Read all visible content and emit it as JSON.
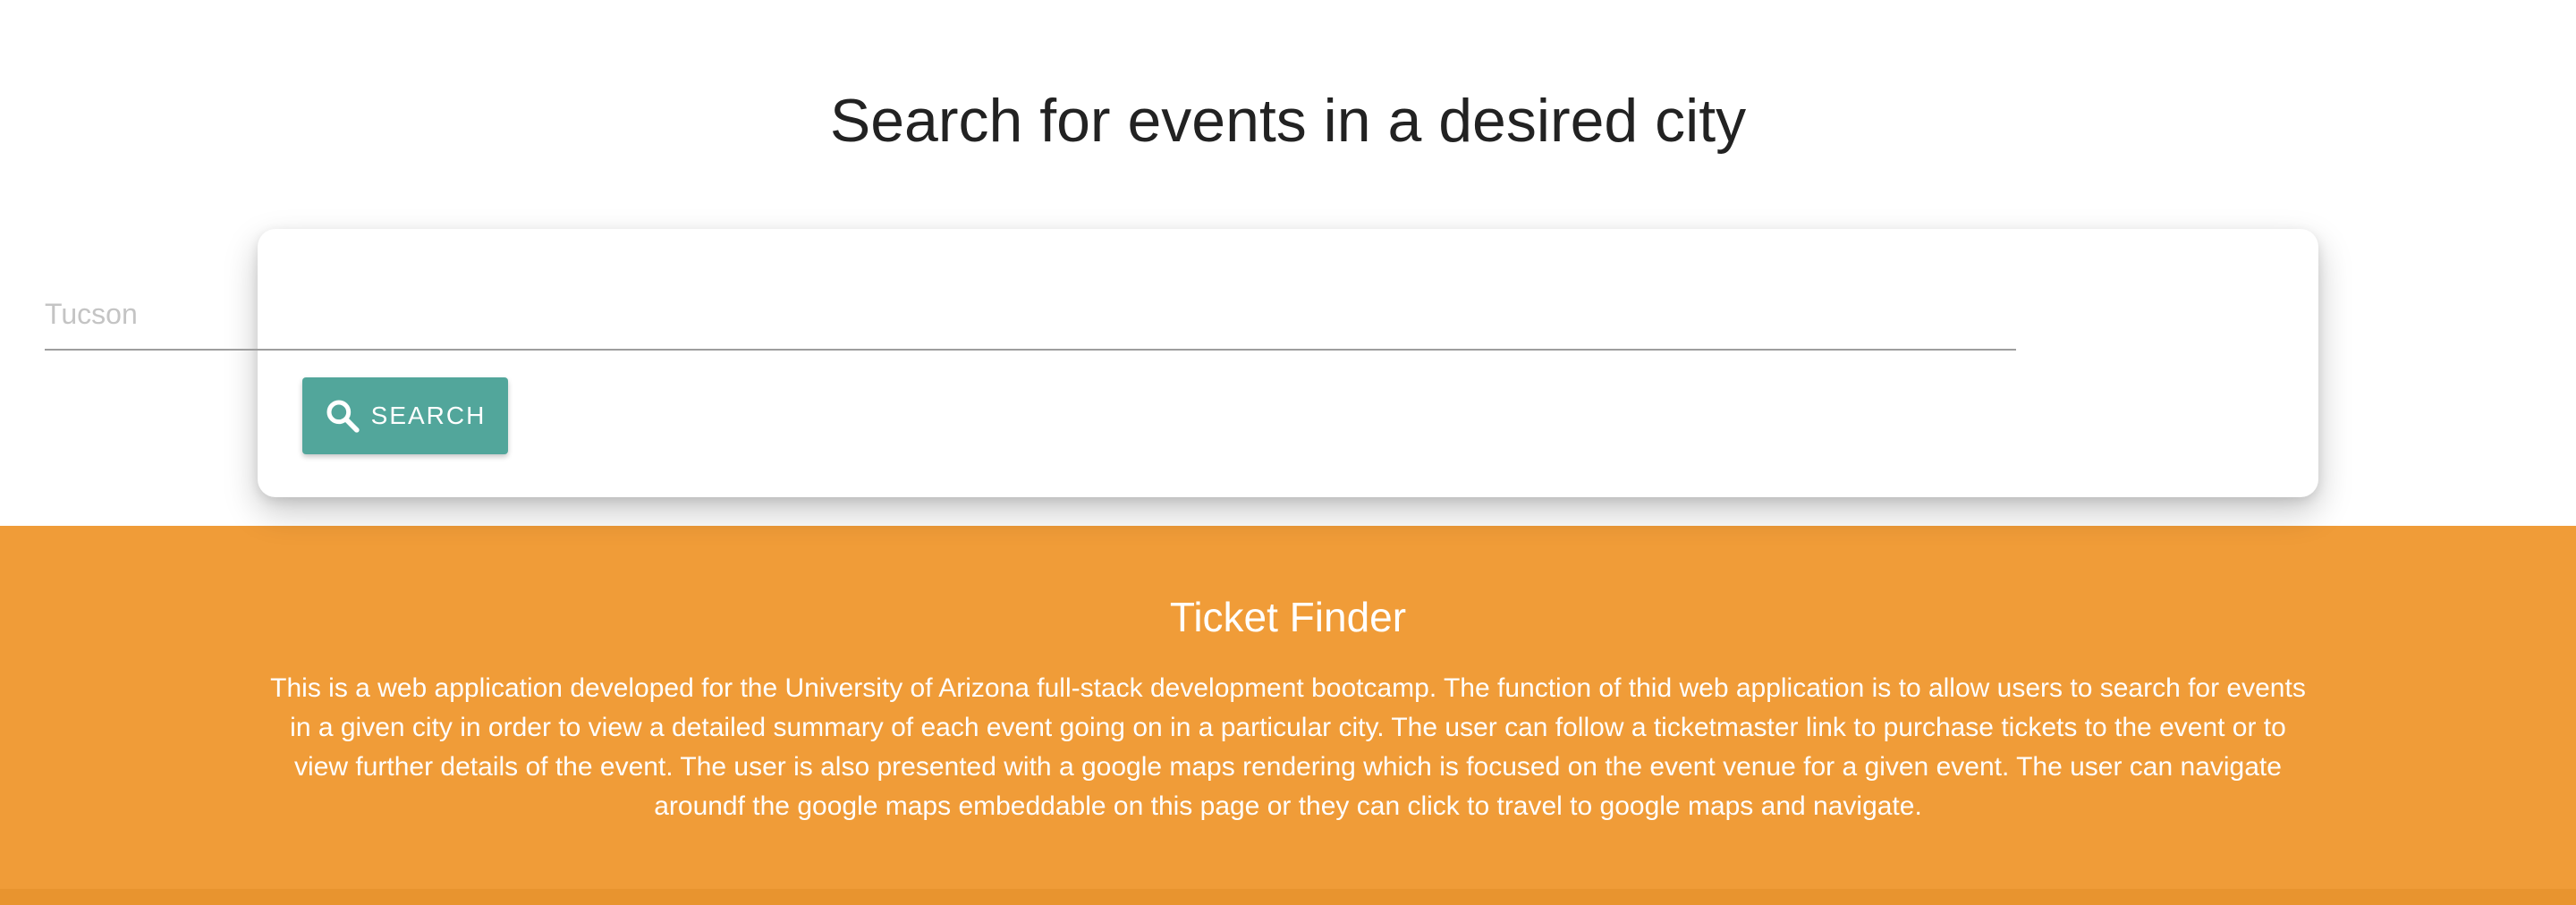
{
  "header": {
    "title": "Search for events in a desired city"
  },
  "search": {
    "placeholder": "Tucson",
    "value": "",
    "button_label": "SEARCH",
    "button_icon": "search-icon"
  },
  "footer": {
    "title": "Ticket Finder",
    "description": "This is a web application developed for the University of Arizona full-stack development bootcamp. The function of thid web application is to allow users to search for events in a given city in order to view a detailed summary of each event going on in a particular city. The user can follow a ticketmaster link to purchase tickets to the event or to view further details of the event. The user is also presented with a google maps rendering which is focused on the event venue for a given event. The user can navigate aroundf the google maps embeddable on this page or they can click to travel to google maps and navigate."
  },
  "colors": {
    "accent_button": "#52a69b",
    "footer_background": "#f09c38",
    "title_text": "#222222"
  }
}
